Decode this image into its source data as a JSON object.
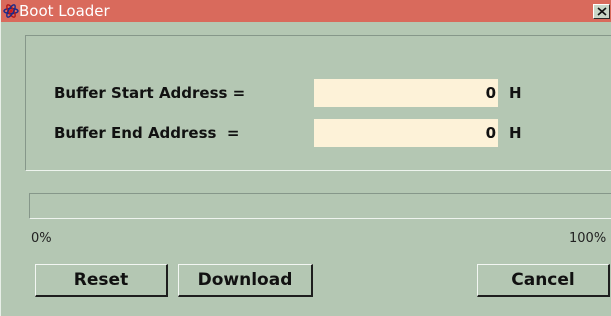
{
  "window": {
    "title": "Boot Loader",
    "app_icon": "atom-icon",
    "close_icon": "close-icon",
    "colors": {
      "titlebar": "#d96a5c",
      "background": "#b4c7b3",
      "field_background": "#fdf2d8"
    }
  },
  "form": {
    "start": {
      "label": "Buffer Start Address =",
      "value": "0",
      "unit": "H"
    },
    "end": {
      "label": "Buffer End Address  =",
      "value": "0",
      "unit": "H"
    }
  },
  "progress": {
    "fraction": 0,
    "min_label": "0%",
    "max_label": "100%"
  },
  "buttons": {
    "reset": "Reset",
    "download": "Download",
    "cancel": "Cancel"
  }
}
